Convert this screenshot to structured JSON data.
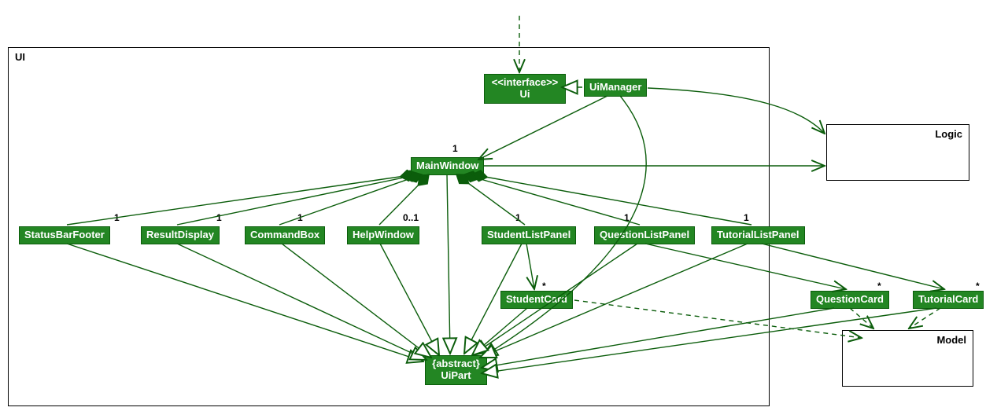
{
  "packages": {
    "ui": {
      "title": "UI"
    },
    "logic": {
      "title": "Logic"
    },
    "model": {
      "title": "Model"
    }
  },
  "nodes": {
    "uiInterface": {
      "stereotype": "<<interface>>",
      "name": "Ui"
    },
    "uiManager": {
      "name": "UiManager"
    },
    "mainWindow": {
      "name": "MainWindow"
    },
    "statusBarFooter": {
      "name": "StatusBarFooter"
    },
    "resultDisplay": {
      "name": "ResultDisplay"
    },
    "commandBox": {
      "name": "CommandBox"
    },
    "helpWindow": {
      "name": "HelpWindow"
    },
    "studentListPanel": {
      "name": "StudentListPanel"
    },
    "questionListPanel": {
      "name": "QuestionListPanel"
    },
    "tutorialListPanel": {
      "name": "TutorialListPanel"
    },
    "studentCard": {
      "name": "StudentCard"
    },
    "questionCard": {
      "name": "QuestionCard"
    },
    "tutorialCard": {
      "name": "TutorialCard"
    },
    "uiPart": {
      "stereotype": "{abstract}",
      "name": "UiPart"
    }
  },
  "multiplicities": {
    "mainWindow": "1",
    "statusBarFooter": "1",
    "resultDisplay": "1",
    "commandBox": "1",
    "helpWindow": "0..1",
    "studentListPanel": "1",
    "questionListPanel": "1",
    "tutorialListPanel": "1",
    "studentCard": "*",
    "questionCard": "*",
    "tutorialCard": "*"
  },
  "chart_data": {
    "type": "uml-class-diagram",
    "packages": [
      "UI",
      "Logic",
      "Model"
    ],
    "classes": [
      {
        "name": "Ui",
        "kind": "interface",
        "package": "UI"
      },
      {
        "name": "UiManager",
        "package": "UI"
      },
      {
        "name": "MainWindow",
        "package": "UI"
      },
      {
        "name": "StatusBarFooter",
        "package": "UI"
      },
      {
        "name": "ResultDisplay",
        "package": "UI"
      },
      {
        "name": "CommandBox",
        "package": "UI"
      },
      {
        "name": "HelpWindow",
        "package": "UI"
      },
      {
        "name": "StudentListPanel",
        "package": "UI"
      },
      {
        "name": "QuestionListPanel",
        "package": "UI"
      },
      {
        "name": "TutorialListPanel",
        "package": "UI"
      },
      {
        "name": "StudentCard",
        "package": "UI"
      },
      {
        "name": "QuestionCard",
        "package": "UI"
      },
      {
        "name": "TutorialCard",
        "package": "UI"
      },
      {
        "name": "UiPart",
        "kind": "abstract",
        "package": "UI"
      }
    ],
    "relationships": [
      {
        "from": "UiManager",
        "to": "Ui",
        "type": "realization"
      },
      {
        "from": "UiManager",
        "to": "MainWindow",
        "type": "association",
        "multiplicity": "1"
      },
      {
        "from": "UiManager",
        "to": "Logic",
        "type": "navigable-association"
      },
      {
        "from": "MainWindow",
        "to": "StatusBarFooter",
        "type": "composition",
        "multiplicity": "1"
      },
      {
        "from": "MainWindow",
        "to": "ResultDisplay",
        "type": "composition",
        "multiplicity": "1"
      },
      {
        "from": "MainWindow",
        "to": "CommandBox",
        "type": "composition",
        "multiplicity": "1"
      },
      {
        "from": "MainWindow",
        "to": "HelpWindow",
        "type": "composition",
        "multiplicity": "0..1"
      },
      {
        "from": "MainWindow",
        "to": "StudentListPanel",
        "type": "composition",
        "multiplicity": "1"
      },
      {
        "from": "MainWindow",
        "to": "QuestionListPanel",
        "type": "composition",
        "multiplicity": "1"
      },
      {
        "from": "MainWindow",
        "to": "TutorialListPanel",
        "type": "composition",
        "multiplicity": "1"
      },
      {
        "from": "MainWindow",
        "to": "Logic",
        "type": "navigable-association"
      },
      {
        "from": "StudentListPanel",
        "to": "StudentCard",
        "type": "navigable-association",
        "multiplicity": "*"
      },
      {
        "from": "QuestionListPanel",
        "to": "QuestionCard",
        "type": "navigable-association",
        "multiplicity": "*"
      },
      {
        "from": "TutorialListPanel",
        "to": "TutorialCard",
        "type": "navigable-association",
        "multiplicity": "*"
      },
      {
        "from": "StudentCard",
        "to": "Model",
        "type": "dependency"
      },
      {
        "from": "QuestionCard",
        "to": "Model",
        "type": "dependency"
      },
      {
        "from": "TutorialCard",
        "to": "Model",
        "type": "dependency"
      },
      {
        "from": "MainWindow",
        "to": "UiPart",
        "type": "generalization"
      },
      {
        "from": "UiManager",
        "to": "UiPart",
        "type": "generalization"
      },
      {
        "from": "StatusBarFooter",
        "to": "UiPart",
        "type": "generalization"
      },
      {
        "from": "ResultDisplay",
        "to": "UiPart",
        "type": "generalization"
      },
      {
        "from": "CommandBox",
        "to": "UiPart",
        "type": "generalization"
      },
      {
        "from": "HelpWindow",
        "to": "UiPart",
        "type": "generalization"
      },
      {
        "from": "StudentListPanel",
        "to": "UiPart",
        "type": "generalization"
      },
      {
        "from": "QuestionListPanel",
        "to": "UiPart",
        "type": "generalization"
      },
      {
        "from": "TutorialListPanel",
        "to": "UiPart",
        "type": "generalization"
      },
      {
        "from": "StudentCard",
        "to": "UiPart",
        "type": "generalization"
      },
      {
        "from": "QuestionCard",
        "to": "UiPart",
        "type": "generalization"
      },
      {
        "from": "TutorialCard",
        "to": "UiPart",
        "type": "generalization"
      },
      {
        "from": "(external)",
        "to": "Ui",
        "type": "dependency"
      }
    ]
  }
}
